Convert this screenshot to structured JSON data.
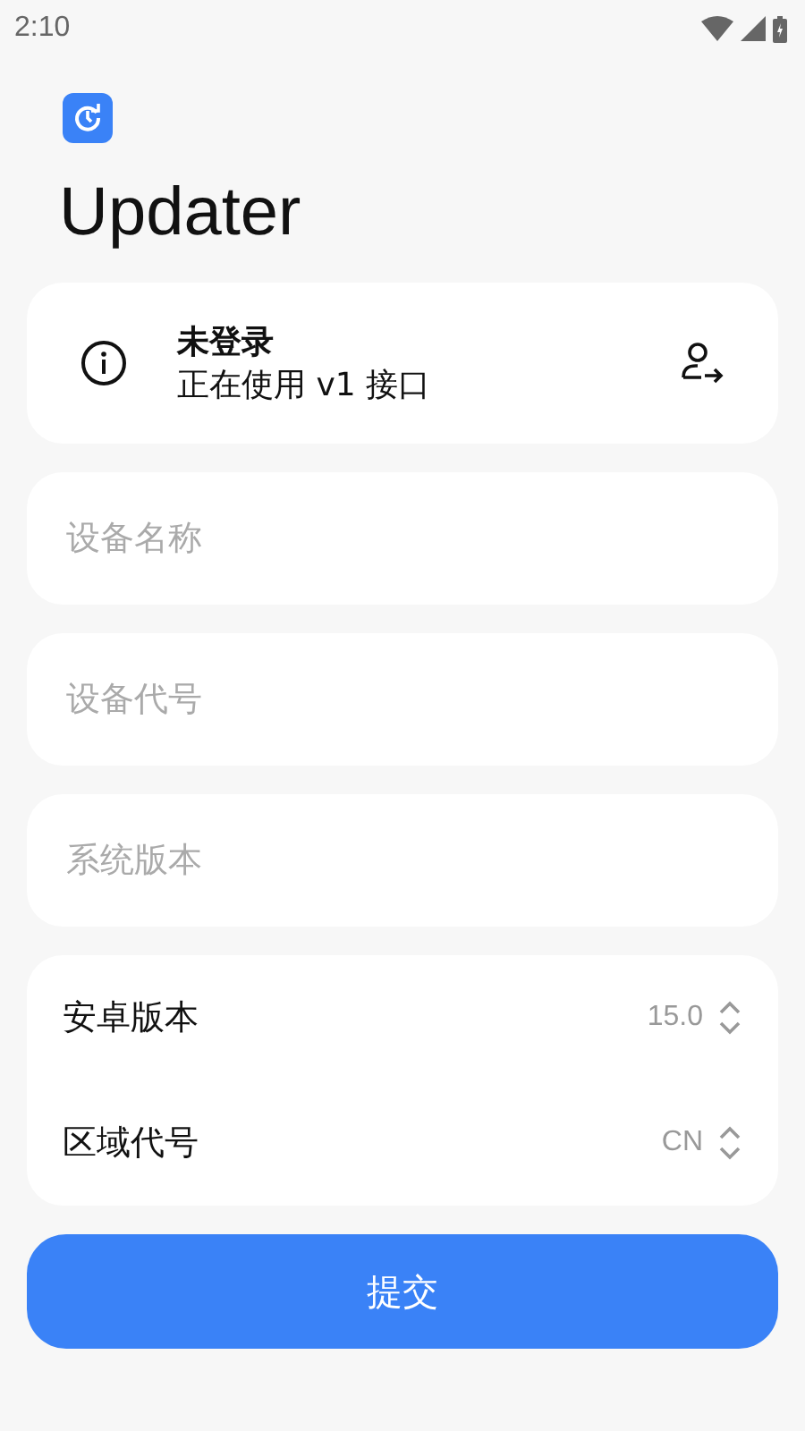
{
  "status_bar": {
    "time": "2:10"
  },
  "app": {
    "title": "Updater"
  },
  "account_card": {
    "title": "未登录",
    "subtitle": "正在使用 v1 接口"
  },
  "fields": [
    {
      "placeholder": "设备名称"
    },
    {
      "placeholder": "设备代号"
    },
    {
      "placeholder": "系统版本"
    }
  ],
  "selects": [
    {
      "label": "安卓版本",
      "value": "15.0"
    },
    {
      "label": "区域代号",
      "value": "CN"
    }
  ],
  "submit_button": {
    "label": "提交"
  }
}
